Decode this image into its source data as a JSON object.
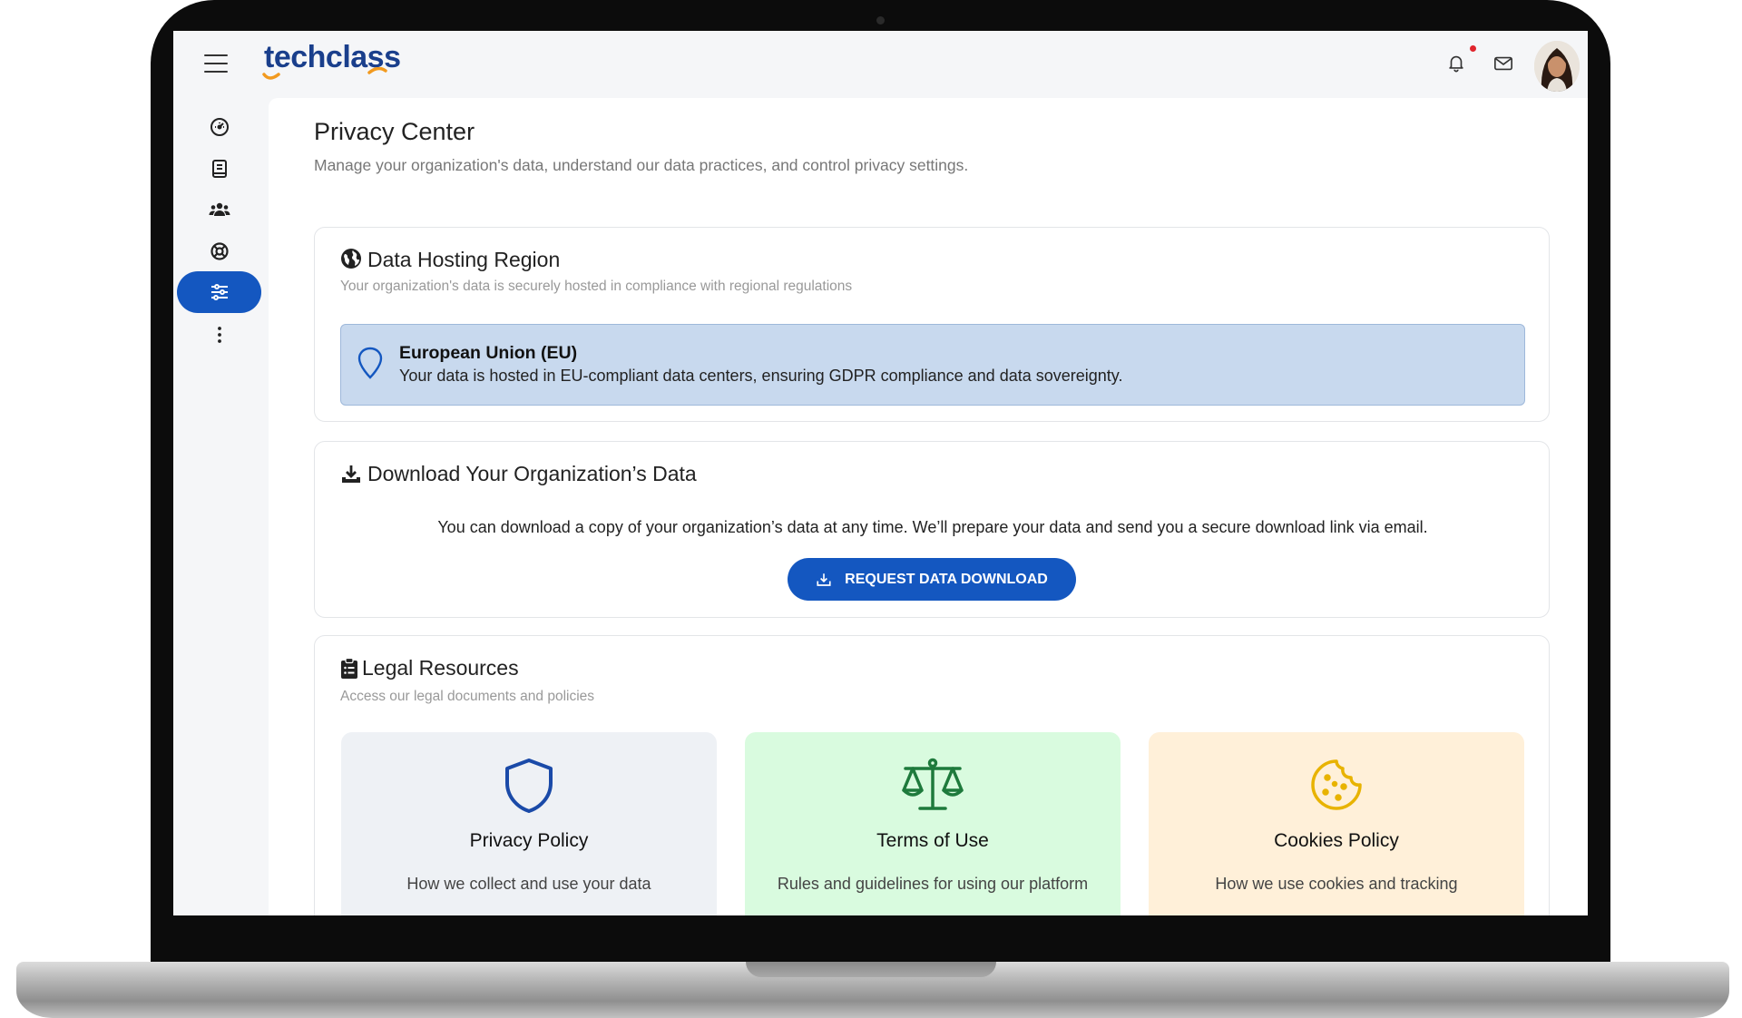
{
  "app": {
    "logo_text": "techclass"
  },
  "header": {
    "notification_badge_color": "#e0242c"
  },
  "sidebar": {
    "items": [
      {
        "icon": "dashboard-gauge-icon",
        "active": false
      },
      {
        "icon": "book-icon",
        "active": false
      },
      {
        "icon": "users-group-icon",
        "active": false
      },
      {
        "icon": "support-lifebuoy-icon",
        "active": false
      },
      {
        "icon": "settings-sliders-icon",
        "active": true
      },
      {
        "icon": "more-vertical-icon",
        "active": false
      }
    ],
    "accent_color": "#1457c0"
  },
  "main": {
    "title": "Privacy Center",
    "subtitle": "Manage your organization's data, understand our data practices, and control privacy settings.",
    "hosting": {
      "title": "Data Hosting Region",
      "subtitle": "Your organization's data is securely hosted in compliance with regional regulations",
      "region_name": "European Union (EU)",
      "region_description": "Your data is hosted in EU-compliant data centers, ensuring GDPR compliance and data sovereignty."
    },
    "download": {
      "title": "Download Your Organization’s Data",
      "description": "You can download a copy of your organization’s data at any time. We’ll prepare your data and send you a secure download link via email.",
      "button_label": "REQUEST DATA DOWNLOAD"
    },
    "legal": {
      "title": "Legal Resources",
      "subtitle": "Access our legal documents and policies",
      "cards": [
        {
          "title": "Privacy Policy",
          "description": "How we collect and use your data",
          "icon": "shield-icon",
          "bg": "#eef1f5",
          "icon_color": "#1a4aa8"
        },
        {
          "title": "Terms of Use",
          "description": "Rules and guidelines for using our platform",
          "icon": "scales-icon",
          "bg": "#d9fbdf",
          "icon_color": "#1e7a3c"
        },
        {
          "title": "Cookies Policy",
          "description": "How we use cookies and tracking",
          "icon": "cookie-icon",
          "bg": "#fff0d9",
          "icon_color": "#e8b300"
        }
      ]
    }
  }
}
